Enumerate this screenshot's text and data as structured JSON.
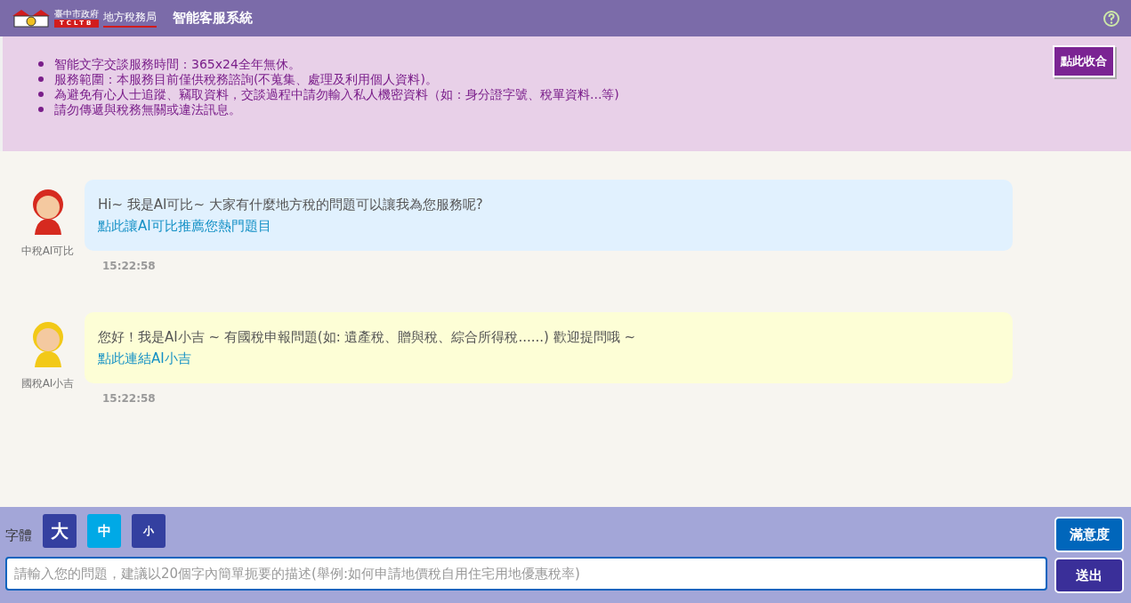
{
  "header": {
    "logo": {
      "small_text": "臺中市政府",
      "tag": "TCLTB",
      "name": "地方稅務局"
    },
    "title": "智能客服系統"
  },
  "notice": {
    "items": [
      "智能文字交談服務時間：365x24全年無休。",
      "服務範圍：本服務目前僅供稅務諮詢(不蒐集、處理及利用個人資料)。",
      "為避免有心人士追蹤、竊取資料，交談過程中請勿輸入私人機密資料（如：身分證字號、稅單資料...等)",
      "請勿傳遞與稅務無關或違法訊息。"
    ],
    "collapse_button": "點此收合"
  },
  "messages": [
    {
      "sender": "中稅AI可比",
      "color": "#e1f1fe",
      "text": "Hi~ 我是AI可比~ 大家有什麼地方稅的問題可以讓我為您服務呢?",
      "link": "點此讓AI可比推薦您熱門題目",
      "time": "15:22:58"
    },
    {
      "sender": "國稅AI小吉",
      "color": "#fdfed6",
      "text": "您好！我是AI小吉 ~ 有國稅申報問題(如: 遺產稅、贈與稅、綜合所得稅......) 歡迎提問哦 ~",
      "link": "點此連結AI小吉",
      "time": "15:22:58"
    }
  ],
  "font_size": {
    "label": "字體",
    "options": [
      {
        "label": "大",
        "selected": false
      },
      {
        "label": "中",
        "selected": true
      },
      {
        "label": "小",
        "selected": false
      }
    ]
  },
  "input": {
    "placeholder": "請輸入您的問題，建議以20個字內簡單扼要的描述(舉例:如何申請地價稅自用住宅用地優惠稅率)"
  },
  "buttons": {
    "satisfaction": "滿意度",
    "send": "送出"
  }
}
